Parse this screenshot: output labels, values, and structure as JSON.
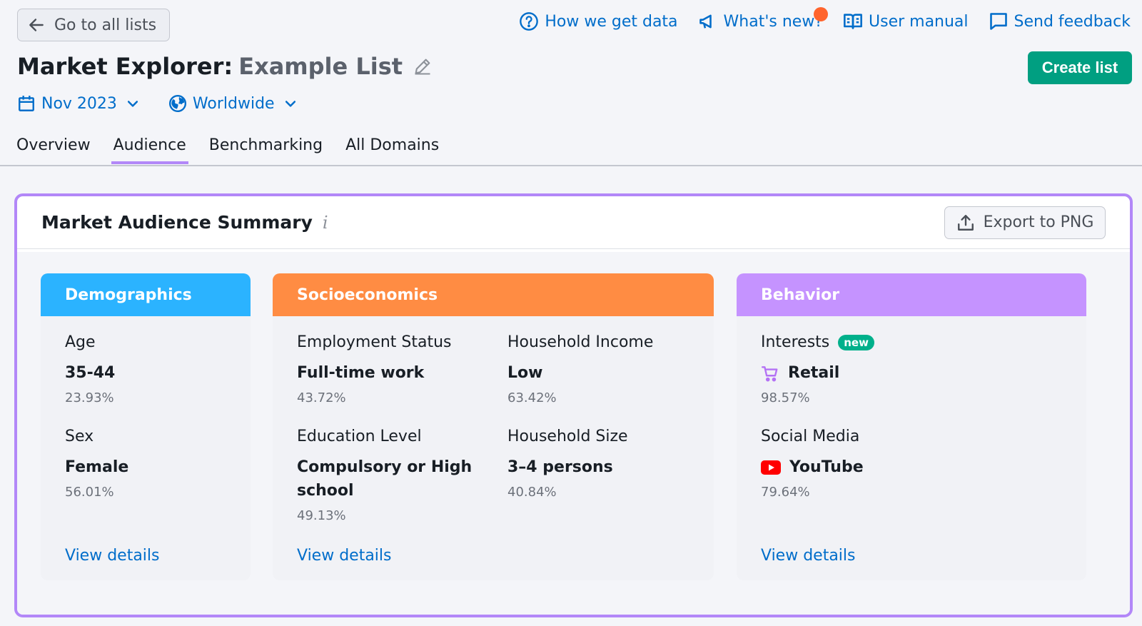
{
  "nav": {
    "back_label": "Go to all lists",
    "links": [
      {
        "label": "How we get data"
      },
      {
        "label": "What's new?"
      },
      {
        "label": "User manual"
      },
      {
        "label": "Send feedback"
      }
    ]
  },
  "header": {
    "title_prefix": "Market Explorer:",
    "list_name": "Example List",
    "create_label": "Create list"
  },
  "filters": {
    "date": "Nov 2023",
    "region": "Worldwide"
  },
  "tabs": [
    {
      "label": "Overview"
    },
    {
      "label": "Audience",
      "active": true
    },
    {
      "label": "Benchmarking"
    },
    {
      "label": "All Domains"
    }
  ],
  "summary": {
    "title": "Market Audience Summary",
    "info_glyph": "i",
    "export_label": "Export to PNG",
    "view_details": "View details",
    "demographics": {
      "title": "Demographics",
      "age": {
        "label": "Age",
        "value": "35-44",
        "pct": "23.93%"
      },
      "sex": {
        "label": "Sex",
        "value": "Female",
        "pct": "56.01%"
      }
    },
    "socioeconomics": {
      "title": "Socioeconomics",
      "employment": {
        "label": "Employment Status",
        "value": "Full-time work",
        "pct": "43.72%"
      },
      "income": {
        "label": "Household Income",
        "value": "Low",
        "pct": "63.42%"
      },
      "education": {
        "label": "Education Level",
        "value": "Compulsory or High school",
        "pct": "49.13%"
      },
      "size": {
        "label": "Household Size",
        "value": "3–4 persons",
        "pct": "40.84%"
      }
    },
    "behavior": {
      "title": "Behavior",
      "interests": {
        "label": "Interests",
        "badge": "new",
        "value": "Retail",
        "pct": "98.57%"
      },
      "social": {
        "label": "Social Media",
        "value": "YouTube",
        "pct": "79.64%"
      }
    }
  },
  "colors": {
    "accent_link": "#006dca",
    "create_button": "#009f81",
    "demographics": "#2bb3ff",
    "socioeconomics": "#ff8c43",
    "behavior": "#c593ff",
    "highlight_border": "#b287f8",
    "notification": "#ff642d"
  },
  "icons": {
    "back": "arrow-left-icon",
    "help": "question-circle-icon",
    "news": "megaphone-icon",
    "manual": "book-icon",
    "feedback": "chat-icon",
    "edit": "pencil-icon",
    "calendar": "calendar-icon",
    "globe": "globe-icon",
    "export": "upload-icon",
    "retail": "cart-icon",
    "youtube": "youtube-icon"
  }
}
